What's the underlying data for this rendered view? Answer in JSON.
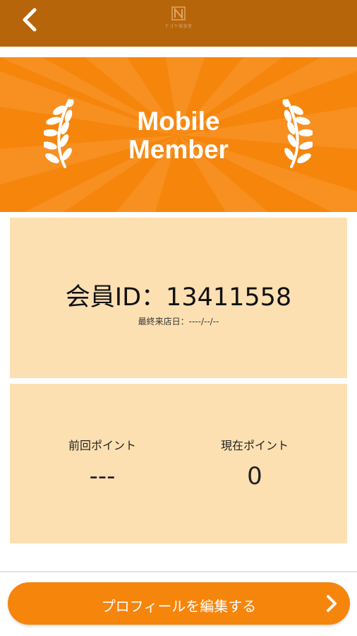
{
  "header": {
    "back_icon": "chevron-left-icon",
    "logo_icon": "brand-logo-icon",
    "logo_text": "ナゴヤ美容室",
    "background_color": "#b7650a"
  },
  "banner": {
    "title_line1": "Mobile",
    "title_line2": "Member",
    "decoration_icon": "laurel-icon",
    "background_color": "#f6850c"
  },
  "member_card": {
    "member_id": "会員ID：13411558",
    "last_visit": "最終来店日：----/--/--",
    "background_color": "#fde0b2"
  },
  "points_card": {
    "previous_label": "前回ポイント",
    "previous_value": "---",
    "current_label": "現在ポイント",
    "current_value": "0"
  },
  "footer": {
    "edit_profile_label": "プロフィールを編集する",
    "chevron_icon": "chevron-right-icon",
    "accent_color": "#f6850c"
  }
}
